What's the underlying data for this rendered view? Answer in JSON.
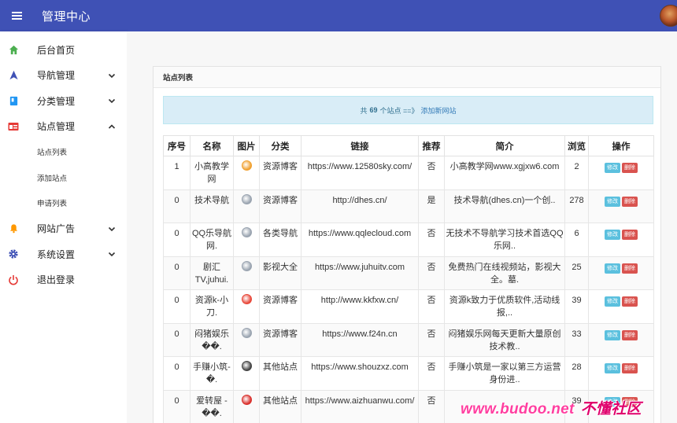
{
  "header": {
    "title": "管理中心"
  },
  "sidebar": {
    "items": [
      {
        "label": "后台首页"
      },
      {
        "label": "导航管理"
      },
      {
        "label": "分类管理"
      },
      {
        "label": "站点管理"
      },
      {
        "label": "网站广告"
      },
      {
        "label": "系统设置"
      },
      {
        "label": "退出登录"
      }
    ],
    "sub_items": [
      {
        "label": "站点列表"
      },
      {
        "label": "添加站点"
      },
      {
        "label": "申请列表"
      }
    ]
  },
  "card": {
    "title": "站点列表",
    "summary_prefix": "共",
    "summary_count": "69",
    "summary_suffix": "个站点 ==》",
    "add_link": "添加新网站"
  },
  "table": {
    "headers": [
      "序号",
      "名称",
      "图片",
      "分类",
      "链接",
      "推荐",
      "简介",
      "浏览",
      "操作"
    ],
    "edit_label": "修改",
    "delete_label": "删除",
    "rows": [
      {
        "id": "1",
        "name": "小高教学网",
        "cat": "资源博客",
        "url": "https://www.12580sky.com/",
        "rec": "否",
        "intro": "小高教学网www.xgjxw6.com",
        "views": "2",
        "icon_color": "#f0a030"
      },
      {
        "id": "0",
        "name": "技术导航",
        "cat": "资源博客",
        "url": "http://dhes.cn/",
        "rec": "是",
        "intro": "技术导航(dhes.cn)一个创..",
        "views": "278",
        "icon_color": "#9aa4b0"
      },
      {
        "id": "0",
        "name": "QQ乐导航网.",
        "cat": "各类导航",
        "url": "https://www.qqlecloud.com",
        "rec": "否",
        "intro": "无技术不导航学习技术首选QQ乐网..",
        "views": "6",
        "icon_color": "#9aa4b0"
      },
      {
        "id": "0",
        "name": "剧汇TV,juhui.",
        "cat": "影视大全",
        "url": "https://www.juhuitv.com",
        "rec": "否",
        "intro": "免费热门在线视频站，影视大全。墓.",
        "views": "25",
        "icon_color": "#9aa4b0"
      },
      {
        "id": "0",
        "name": "资源k-小刀.",
        "cat": "资源博客",
        "url": "http://www.kkfxw.cn/",
        "rec": "否",
        "intro": "资源k致力于优质软件,活动线报,..",
        "views": "39",
        "icon_color": "#e8483a"
      },
      {
        "id": "0",
        "name": "闷猪娱乐��.",
        "cat": "资源博客",
        "url": "https://www.f24n.cn",
        "rec": "否",
        "intro": "闷猪娱乐网每天更新大量原创技术教..",
        "views": "33",
        "icon_color": "#9aa4b0"
      },
      {
        "id": "0",
        "name": "手赚小筑-�.",
        "cat": "其他站点",
        "url": "https://www.shouzxz.com",
        "rec": "否",
        "intro": "手赚小筑是一家以第三方运营身份进..",
        "views": "28",
        "icon_color": "#444444"
      },
      {
        "id": "0",
        "name": "爱转屋 - ��.",
        "cat": "其他站点",
        "url": "https://www.aizhuanwu.com/",
        "rec": "否",
        "intro": "",
        "views": "39",
        "icon_color": "#d9302c"
      }
    ]
  },
  "watermark": {
    "text": "www.budoo.net",
    "cn": "不懂社区"
  },
  "colors": {
    "primary": "#3f51b5",
    "info_bg": "#d9edf7",
    "edit": "#5bc0de",
    "delete": "#d9534f"
  }
}
